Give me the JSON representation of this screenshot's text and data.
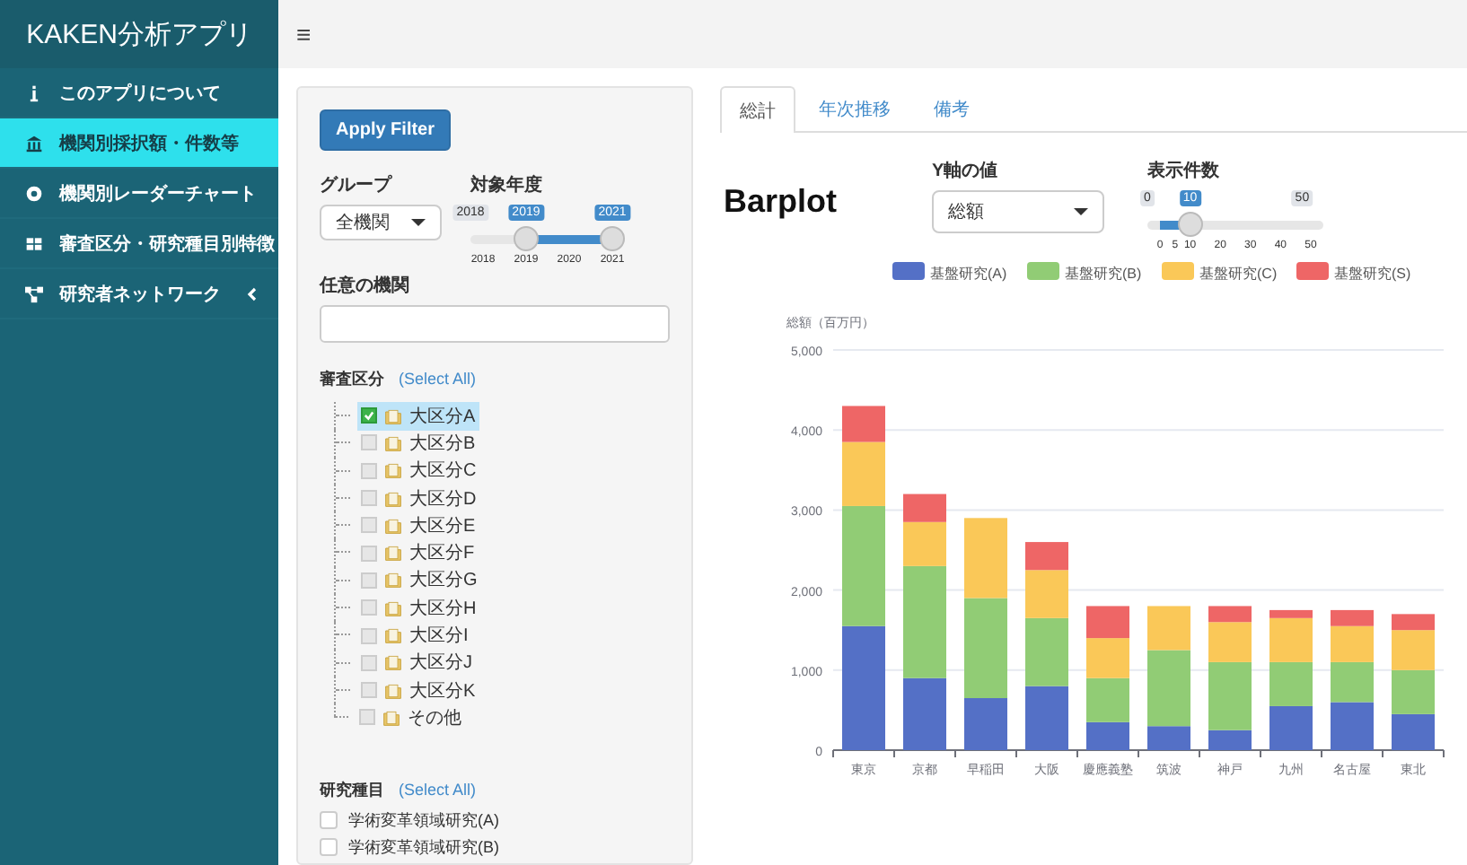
{
  "app_title": "KAKEN分析アプリ",
  "menu_toggle": "≡",
  "sidebar": {
    "items": [
      {
        "label": "このアプリについて",
        "selected": false,
        "expandable": false
      },
      {
        "label": "機関別採択額・件数等",
        "selected": true,
        "expandable": false
      },
      {
        "label": "機関別レーダーチャート",
        "selected": false,
        "expandable": false
      },
      {
        "label": "審査区分・研究種目別特徴",
        "selected": false,
        "expandable": false
      },
      {
        "label": "研究者ネットワーク",
        "selected": false,
        "expandable": true
      }
    ]
  },
  "filters": {
    "apply_button": "Apply Filter",
    "group": {
      "label": "グループ",
      "value": "全機関"
    },
    "year": {
      "label": "対象年度",
      "min": "2018",
      "handles": [
        {
          "value": "2019",
          "level": 0.333
        },
        {
          "value": "2021",
          "level": 1
        }
      ],
      "ticks": [
        "2018",
        "2019",
        "2020",
        "2021"
      ]
    },
    "institution": {
      "label": "任意の機関"
    },
    "review_section": {
      "label": "審査区分",
      "select_all": "(Select All)",
      "items": [
        {
          "label": "大区分A",
          "checked": true,
          "selected": true
        },
        {
          "label": "大区分B",
          "checked": false,
          "selected": false
        },
        {
          "label": "大区分C",
          "checked": false,
          "selected": false
        },
        {
          "label": "大区分D",
          "checked": false,
          "selected": false
        },
        {
          "label": "大区分E",
          "checked": false,
          "selected": false
        },
        {
          "label": "大区分F",
          "checked": false,
          "selected": false
        },
        {
          "label": "大区分G",
          "checked": false,
          "selected": false
        },
        {
          "label": "大区分H",
          "checked": false,
          "selected": false
        },
        {
          "label": "大区分I",
          "checked": false,
          "selected": false
        },
        {
          "label": "大区分J",
          "checked": false,
          "selected": false
        },
        {
          "label": "大区分K",
          "checked": false,
          "selected": false
        },
        {
          "label": "その他",
          "checked": false,
          "selected": false
        }
      ]
    },
    "research_type": {
      "label": "研究種目",
      "select_all": "(Select All)",
      "items": [
        {
          "label": "学術変革領域研究(A)",
          "checked": false
        },
        {
          "label": "学術変革領域研究(B)",
          "checked": false
        }
      ]
    }
  },
  "tabs": [
    {
      "label": "総計",
      "selected": true
    },
    {
      "label": "年次推移",
      "selected": false
    },
    {
      "label": "備考",
      "selected": false
    }
  ],
  "heading": "Barplot",
  "y_axis_select": {
    "label": "Y軸の値",
    "value": "総額"
  },
  "count_slider": {
    "label": "表示件数",
    "min": "0",
    "value": "10",
    "max": "50",
    "level": 0.2,
    "ticks": [
      "0",
      "5",
      "10",
      "20",
      "30",
      "40",
      "50"
    ]
  },
  "chart_data": {
    "type": "bar",
    "stacked": true,
    "grid": true,
    "legend": true,
    "ylabel": "総額（百万円）",
    "categories": [
      "東京",
      "京都",
      "早稲田",
      "大阪",
      "慶應義塾",
      "筑波",
      "神戸",
      "九州",
      "名古屋",
      "東北"
    ],
    "series": [
      {
        "name": "基盤研究(A)",
        "color": "#5470c6",
        "values": [
          1550,
          900,
          650,
          800,
          350,
          300,
          250,
          550,
          600,
          450
        ]
      },
      {
        "name": "基盤研究(B)",
        "color": "#91cc75",
        "values": [
          1500,
          1400,
          1250,
          850,
          550,
          950,
          850,
          550,
          500,
          550
        ]
      },
      {
        "name": "基盤研究(C)",
        "color": "#fac858",
        "values": [
          800,
          550,
          1000,
          600,
          500,
          550,
          500,
          550,
          450,
          500
        ]
      },
      {
        "name": "基盤研究(S)",
        "color": "#ee6666",
        "values": [
          450,
          350,
          0,
          350,
          400,
          0,
          200,
          100,
          200,
          200
        ]
      }
    ],
    "ylim": [
      0,
      5000
    ],
    "yticks": [
      {
        "value": 0,
        "label": "0"
      },
      {
        "value": 1000,
        "label": "1,000"
      },
      {
        "value": 2000,
        "label": "2,000"
      },
      {
        "value": 3000,
        "label": "3,000"
      },
      {
        "value": 4000,
        "label": "4,000"
      },
      {
        "value": 5000,
        "label": "5,000"
      }
    ]
  }
}
